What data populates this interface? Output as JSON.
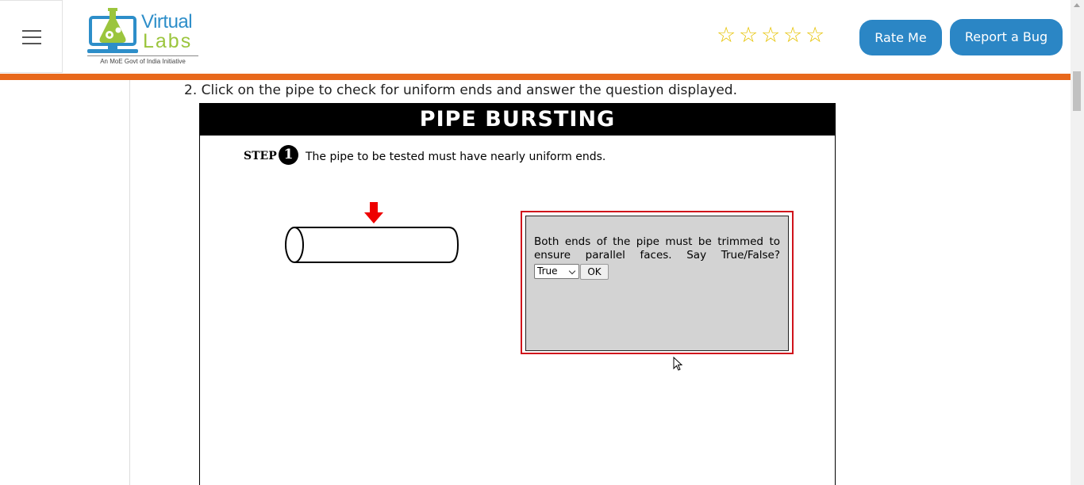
{
  "header": {
    "logo": {
      "name_line1": "Virtual",
      "name_line2": "Labs",
      "tagline": "An MoE Govt of India Initiative",
      "colors": {
        "virtual": "#2d8ec9",
        "labs": "#9bc53d"
      }
    },
    "rating": {
      "stars_total": 5,
      "stars_filled": 0,
      "star_glyph": "☆",
      "color": "#e6c200"
    },
    "buttons": {
      "rate_me": "Rate Me",
      "report_bug": "Report a Bug"
    },
    "accent_color": "#2b86c5",
    "bar_color": "#e8681b"
  },
  "content": {
    "instruction": "2. Click on the pipe to check for uniform ends and answer the question displayed."
  },
  "simulation": {
    "title": "PIPE BURSTING",
    "step_label": "STEP",
    "step_number": "1",
    "step_text": "The pipe to be tested must have nearly uniform ends.",
    "dialog": {
      "question_line1": "Both ends of the pipe must be trimmed to",
      "question_line2": "ensure parallel faces. Say True/False?",
      "select_value": "True",
      "ok_label": "OK",
      "border_color": "#d0121b"
    }
  }
}
